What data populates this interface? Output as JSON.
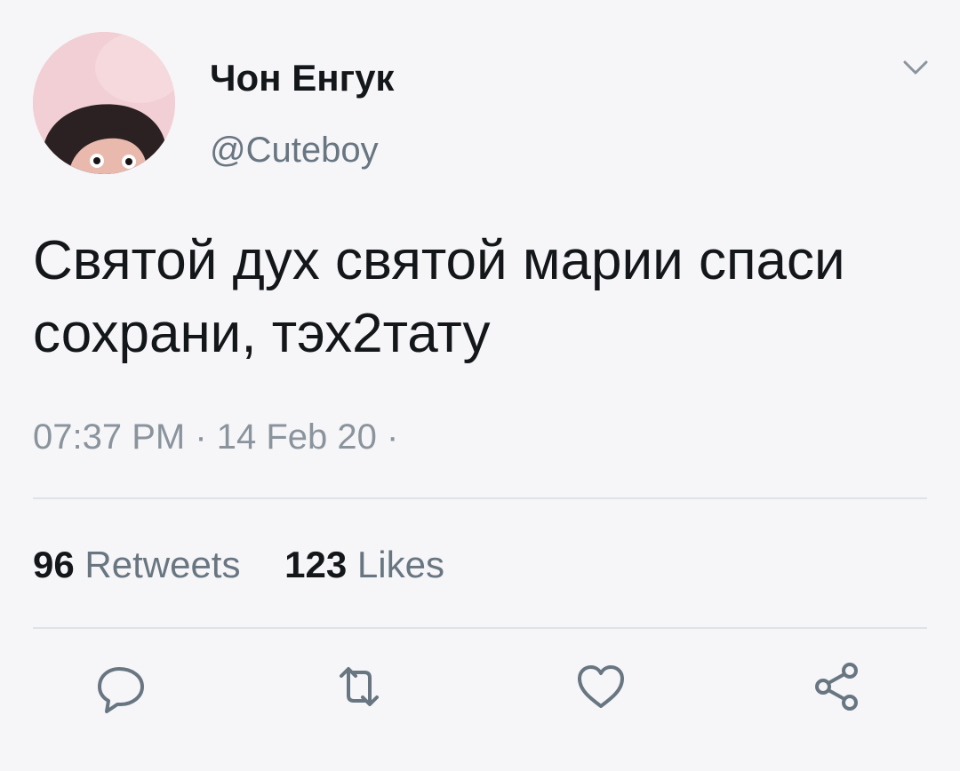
{
  "user": {
    "display_name": "Чон Енгук",
    "handle": "@Cuteboy",
    "avatar_icon": "avatar-photo"
  },
  "tweet": {
    "text": "Святой дух святой марии спаси сохрани, тэх2тату",
    "timestamp": "07:37 PM · 14 Feb 20 ·"
  },
  "stats": {
    "retweets_count": "96",
    "retweets_label": "Retweets",
    "likes_count": "123",
    "likes_label": "Likes"
  },
  "actions": [
    {
      "icon": "reply-icon"
    },
    {
      "icon": "retweet-icon"
    },
    {
      "icon": "like-icon"
    },
    {
      "icon": "share-icon"
    }
  ],
  "colors": {
    "background": "#f6f5f8",
    "text_primary": "#14171a",
    "text_secondary": "#687681",
    "icon": "#687681",
    "divider": "#dfe3e7"
  }
}
